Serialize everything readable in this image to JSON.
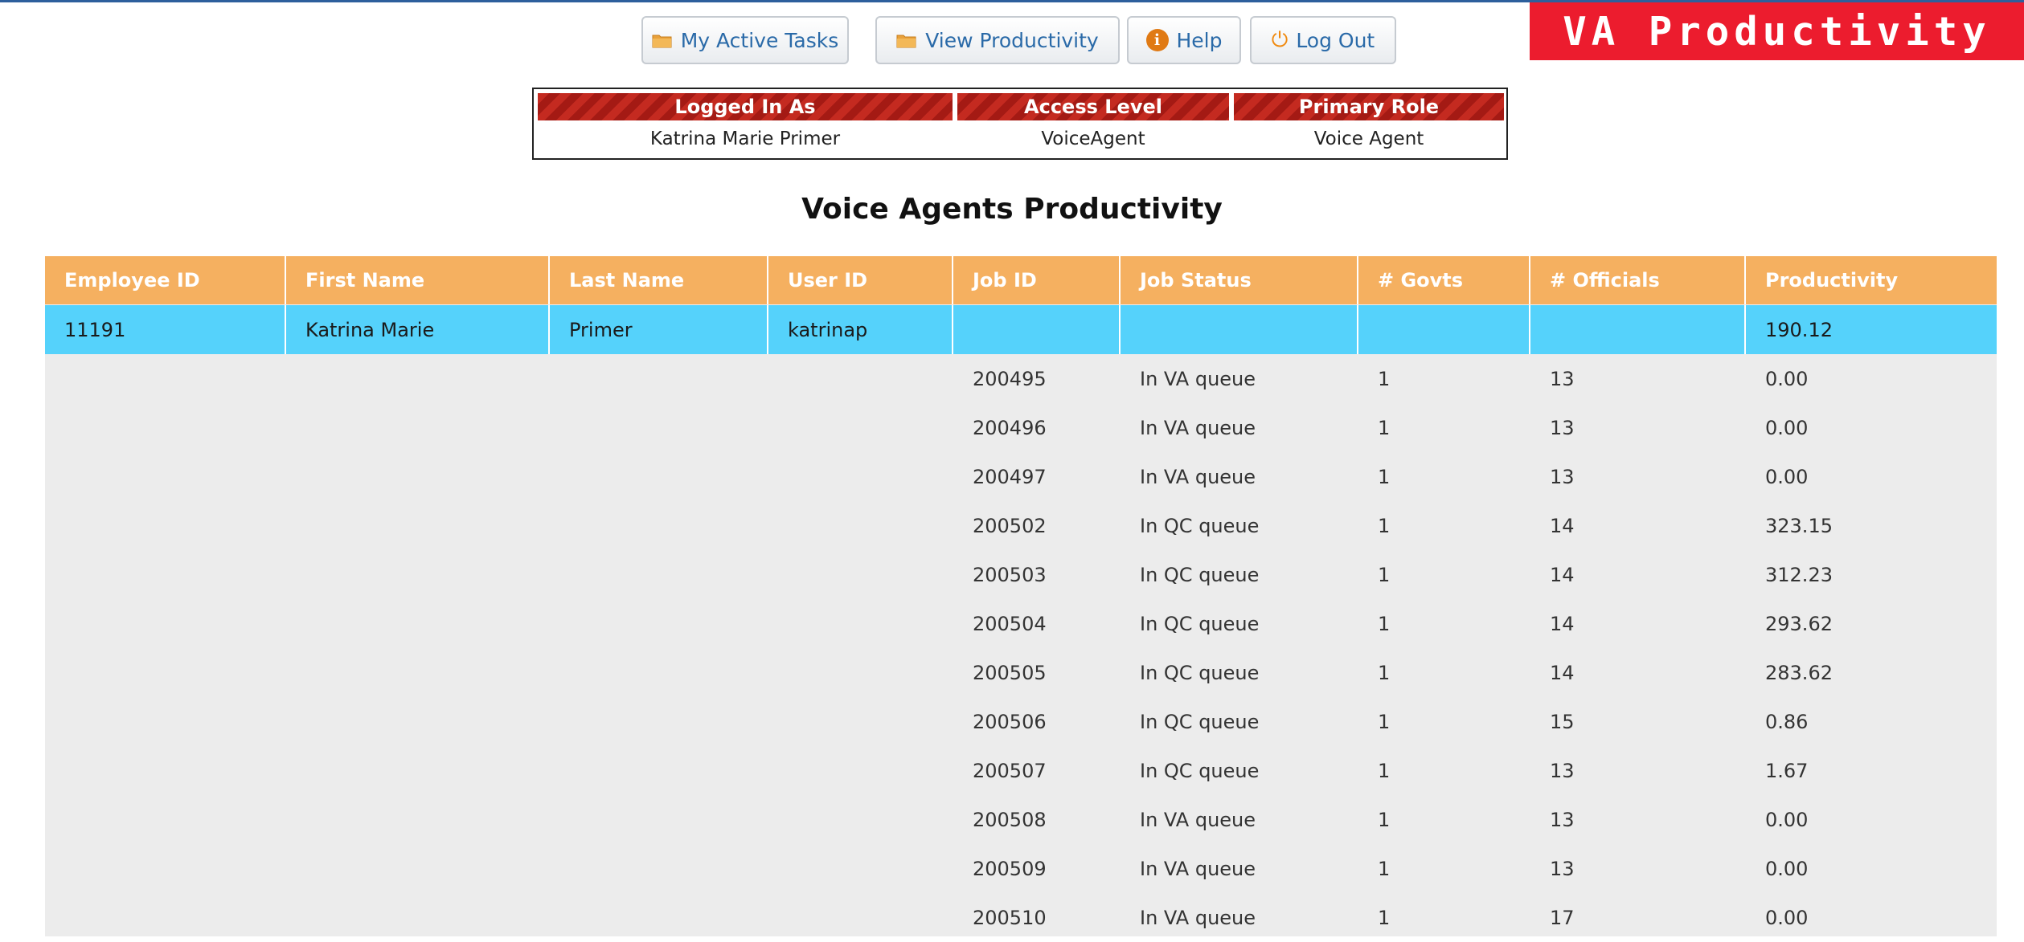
{
  "brand": {
    "title": "VA Productivity",
    "color": "#ec1c2e"
  },
  "nav": {
    "buttons": [
      {
        "label": "My Active Tasks",
        "icon": "folder-icon"
      },
      {
        "label": "View Productivity",
        "icon": "folder-icon"
      },
      {
        "label": "Help",
        "icon": "info-icon"
      },
      {
        "label": "Log Out",
        "icon": "power-icon"
      }
    ]
  },
  "session": {
    "headers": [
      "Logged In As",
      "Access Level",
      "Primary Role"
    ],
    "values": [
      "Katrina Marie Primer",
      "VoiceAgent",
      "Voice Agent"
    ]
  },
  "page": {
    "title": "Voice Agents Productivity"
  },
  "table": {
    "header_color": "#f5b060",
    "highlight_color": "#55d2fb",
    "columns": [
      "Employee ID",
      "First Name",
      "Last Name",
      "User ID",
      "Job ID",
      "Job Status",
      "# Govts",
      "# Officials",
      "Productivity"
    ],
    "agent": {
      "employee_id": "11191",
      "first_name": "Katrina Marie",
      "last_name": "Primer",
      "user_id": "katrinap",
      "productivity": "190.12"
    },
    "jobs": [
      {
        "job_id": "200495",
        "status": "In VA queue",
        "govts": "1",
        "officials": "13",
        "productivity": "0.00"
      },
      {
        "job_id": "200496",
        "status": "In VA queue",
        "govts": "1",
        "officials": "13",
        "productivity": "0.00"
      },
      {
        "job_id": "200497",
        "status": "In VA queue",
        "govts": "1",
        "officials": "13",
        "productivity": "0.00"
      },
      {
        "job_id": "200502",
        "status": "In QC queue",
        "govts": "1",
        "officials": "14",
        "productivity": "323.15"
      },
      {
        "job_id": "200503",
        "status": "In QC queue",
        "govts": "1",
        "officials": "14",
        "productivity": "312.23"
      },
      {
        "job_id": "200504",
        "status": "In QC queue",
        "govts": "1",
        "officials": "14",
        "productivity": "293.62"
      },
      {
        "job_id": "200505",
        "status": "In QC queue",
        "govts": "1",
        "officials": "14",
        "productivity": "283.62"
      },
      {
        "job_id": "200506",
        "status": "In QC queue",
        "govts": "1",
        "officials": "15",
        "productivity": "0.86"
      },
      {
        "job_id": "200507",
        "status": "In QC queue",
        "govts": "1",
        "officials": "13",
        "productivity": "1.67"
      },
      {
        "job_id": "200508",
        "status": "In VA queue",
        "govts": "1",
        "officials": "13",
        "productivity": "0.00"
      },
      {
        "job_id": "200509",
        "status": "In VA queue",
        "govts": "1",
        "officials": "13",
        "productivity": "0.00"
      },
      {
        "job_id": "200510",
        "status": "In VA queue",
        "govts": "1",
        "officials": "17",
        "productivity": "0.00"
      }
    ]
  }
}
